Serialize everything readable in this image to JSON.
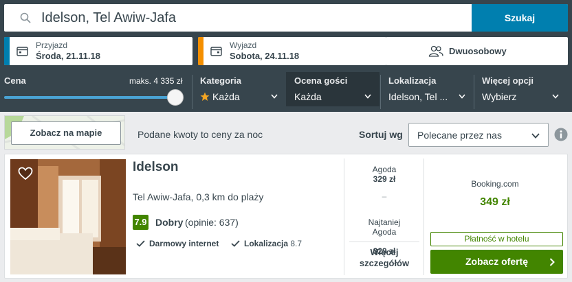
{
  "colors": {
    "accent": "#007faf",
    "checkin_bar": "#007faf",
    "checkout_bar": "#f48f00",
    "rating_green": "#428500",
    "header_bg": "#37454d"
  },
  "search": {
    "value": "Idelson, Tel Awiw-Jafa",
    "button_label": "Szukaj"
  },
  "dates": {
    "checkin": {
      "label": "Przyjazd",
      "value": "Środa, 21.11.18",
      "icon": "calendar-icon"
    },
    "checkout": {
      "label": "Wyjazd",
      "value": "Sobota, 24.11.18",
      "icon": "calendar-icon"
    }
  },
  "room": {
    "label": "Dwuosobowy",
    "icon": "people-icon"
  },
  "filters": {
    "price": {
      "label": "Cena",
      "max_label": "maks. 4 335 zł",
      "level": 1.0
    },
    "category": {
      "label": "Kategoria",
      "value": "Każda",
      "icon": "star-icon"
    },
    "rating": {
      "label": "Ocena gości",
      "value": "Każda"
    },
    "location": {
      "label": "Lokalizacja",
      "value": "Idelson, Tel ..."
    },
    "more": {
      "label": "Więcej opcji",
      "value": "Wybierz"
    }
  },
  "results_bar": {
    "map_button": "Zobacz na mapie",
    "note": "Podane kwoty to ceny za noc",
    "sort_label": "Sortuj wg",
    "sort_value": "Polecane przez nas"
  },
  "hotel": {
    "name": "Idelson",
    "location": "Tel Awiw-Jafa, 0,3 km do plaży",
    "rating_score": "7.9",
    "rating_word": "Dobry",
    "rating_count": "(opinie: 637)",
    "amenities": [
      {
        "label": "Darmowy internet",
        "value": ""
      },
      {
        "label": "Lokalizacja",
        "value": "8.7"
      }
    ],
    "deals": [
      {
        "site": "Agoda",
        "price": "329 zł"
      },
      {
        "site": "Najtaniej\nAgoda",
        "price": "329 zł"
      }
    ],
    "deals_dash": "–",
    "more_details": "Więcej szczegółów",
    "best": {
      "site": "Booking.com",
      "price": "349 zł"
    },
    "pay_badge": "Płatność w hotelu",
    "offer_button": "Zobacz ofertę"
  }
}
